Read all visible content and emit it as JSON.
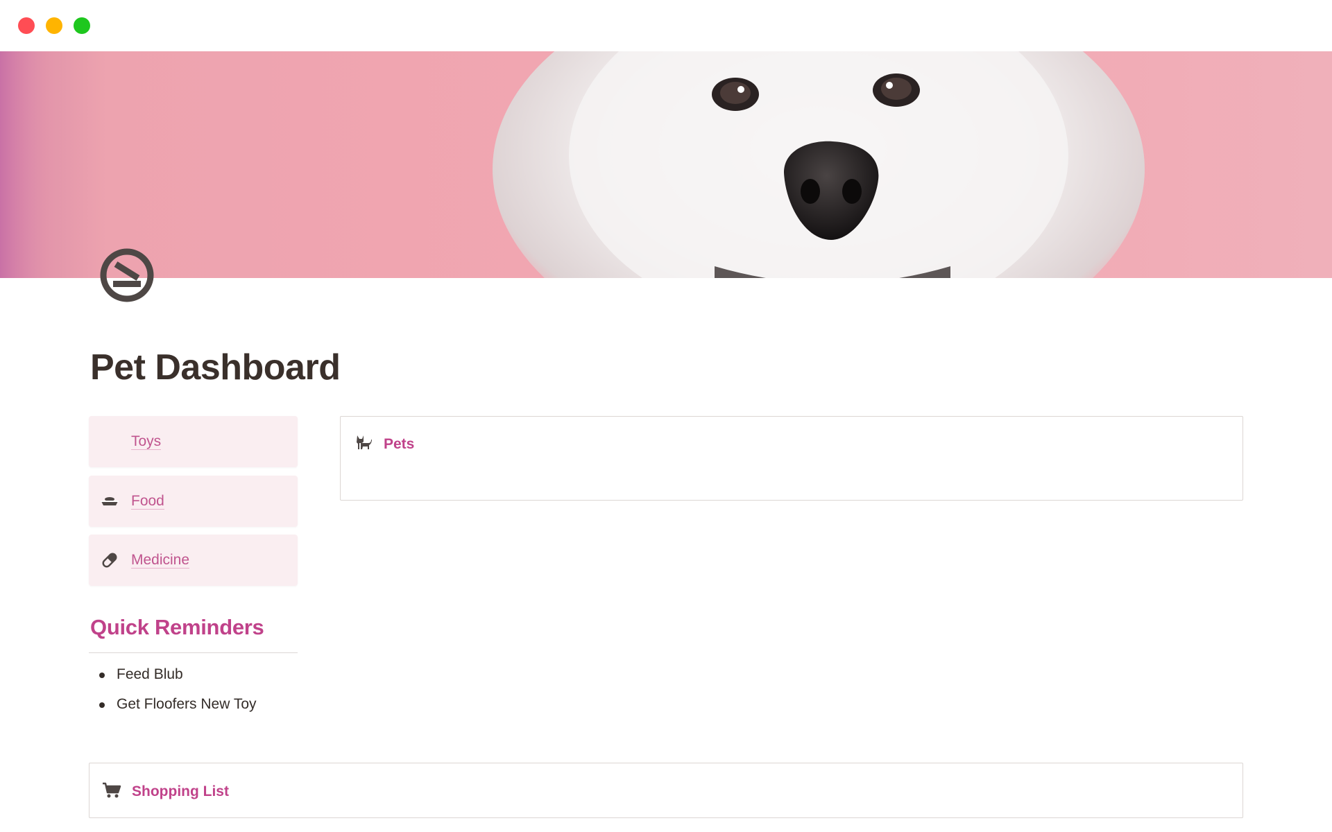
{
  "window": {
    "controls": [
      "close",
      "minimize",
      "maximize"
    ],
    "colors": {
      "close": "#ff4d54",
      "minimize": "#ffb400",
      "maximize": "#1ec71e"
    }
  },
  "cover": {
    "image": "white-samoyed-dog-on-pink-background"
  },
  "page": {
    "icon": "no-smoking-icon",
    "title": "Pet Dashboard"
  },
  "nav_cards": [
    {
      "label": "Toys",
      "icon": "none"
    },
    {
      "label": "Food",
      "icon": "pet-bowl-icon"
    },
    {
      "label": "Medicine",
      "icon": "pill-icon"
    }
  ],
  "reminders": {
    "heading": "Quick Reminders",
    "items": [
      "Feed Blub",
      "Get Floofers New Toy"
    ]
  },
  "linked_databases": {
    "pets": {
      "label": "Pets",
      "icon": "cat-icon"
    },
    "shopping": {
      "label": "Shopping List",
      "icon": "cart-icon"
    }
  },
  "colors": {
    "accent": "#c0428a",
    "link": "#c0548e",
    "card_bg": "#faeef1",
    "cover_pink": "#f1a6b1",
    "text": "#37302c"
  }
}
